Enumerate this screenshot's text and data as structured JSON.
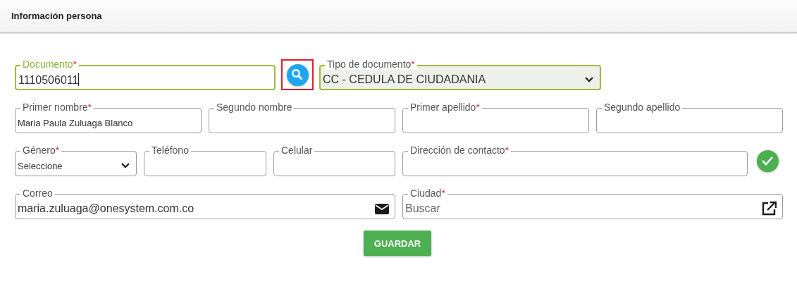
{
  "header": {
    "title": "Información persona"
  },
  "rows": [
    [
      {
        "kind": "text",
        "label": "Documento",
        "required_mark": "*",
        "value": "1110506011",
        "focused": true,
        "highlighted": true,
        "disabled": false
      },
      {
        "kind": "search",
        "annotated": true
      },
      {
        "kind": "select",
        "label": "Tipo de documento",
        "required_mark": "*",
        "value": "CC - CEDULA DE CIUDADANIA",
        "focused": false,
        "highlighted": true,
        "disabled": true
      }
    ],
    [
      {
        "kind": "text",
        "label": "Primer nombre",
        "required_mark": "*",
        "value": "Maria Paula Zuluaga Blanco",
        "focused": false,
        "highlighted": false,
        "disabled": false
      },
      {
        "kind": "text",
        "label": "Segundo nombre",
        "focused": false,
        "highlighted": false,
        "disabled": false
      },
      {
        "kind": "text",
        "label": "Primer apellido",
        "required_mark": "*",
        "focused": false,
        "highlighted": false,
        "disabled": false
      },
      {
        "kind": "text",
        "label": "Segundo apellido",
        "focused": false,
        "highlighted": false,
        "disabled": false
      }
    ],
    [
      {
        "kind": "select",
        "label": "Género",
        "required_mark": "*",
        "value": "Seleccione",
        "focused": false,
        "highlighted": false,
        "disabled": false
      },
      {
        "kind": "text",
        "label": "Teléfono",
        "focused": false,
        "highlighted": false,
        "disabled": false
      },
      {
        "kind": "text",
        "label": "Celular",
        "focused": false,
        "highlighted": false,
        "disabled": false
      },
      {
        "kind": "text",
        "label": "Dirección de contacto",
        "required_mark": "*",
        "focused": false,
        "highlighted": false,
        "disabled": false
      },
      {
        "kind": "confirm",
        "annotated": false
      }
    ],
    [
      {
        "kind": "email",
        "label": "Correo",
        "value": "maria.zuluaga@onesystem.com.co",
        "focused": false,
        "highlighted": false,
        "disabled": false
      },
      {
        "kind": "link",
        "label": "Ciudad",
        "required_mark": "*",
        "placeholder": "Buscar",
        "focused": false,
        "highlighted": false,
        "disabled": false
      }
    ]
  ],
  "save_button": "GUARDAR"
}
